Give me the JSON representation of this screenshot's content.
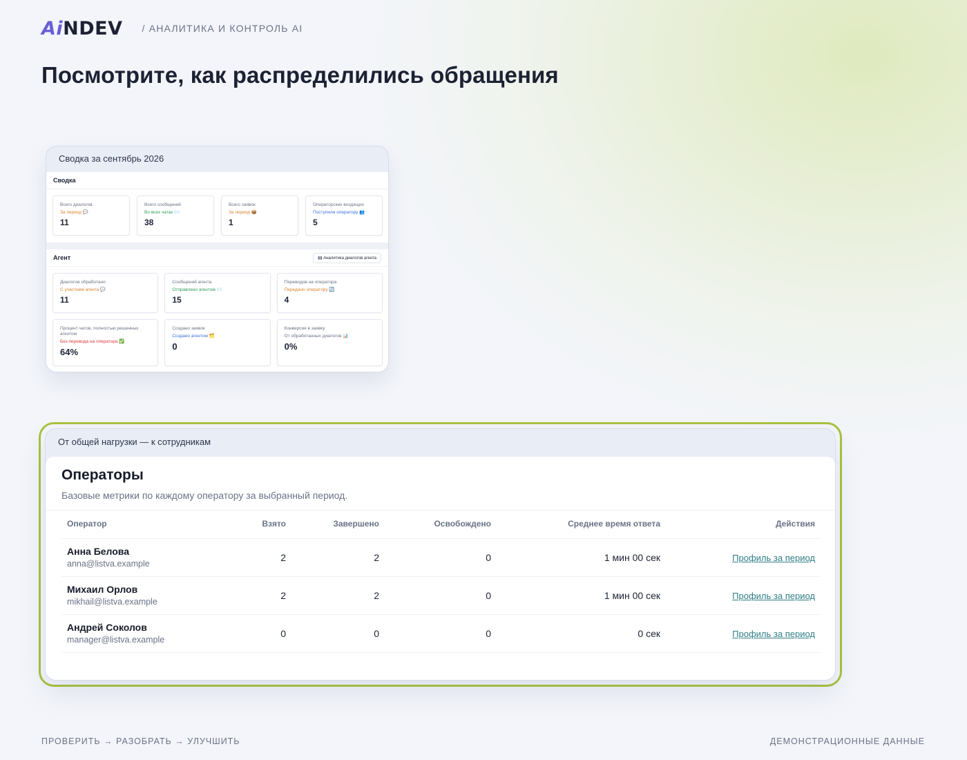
{
  "header": {
    "logo_ai": "Ai",
    "logo_rest": "NDEV",
    "tagline": "/ АНАЛИТИКА И КОНТРОЛЬ AI"
  },
  "page_title": "Посмотрите, как распределились обращения",
  "summary_card": {
    "caption": "Сводка за сентябрь 2026",
    "summary_section": "Сводка",
    "summary_metrics": [
      {
        "label": "Всего диалогов",
        "sub": "За период 💬",
        "value": "11"
      },
      {
        "label": "Всего сообщений",
        "sub": "Во всех чатах ✉️",
        "value": "38"
      },
      {
        "label": "Всего заявок",
        "sub": "За период 📦",
        "value": "1"
      },
      {
        "label": "Операторских входящих",
        "sub": "Поступили оператору 👥",
        "value": "5"
      }
    ],
    "agent_section": "Агент",
    "agent_button": "Аналитика диалогов агента",
    "agent_metrics": [
      {
        "label": "Диалогов обработано",
        "sub": "С участием агента 💬",
        "value": "11"
      },
      {
        "label": "Сообщений агента",
        "sub": "Отправлено агентом ✉️",
        "value": "15"
      },
      {
        "label": "Переводов на оператора",
        "sub": "Передано оператору 🔄",
        "value": "4"
      },
      {
        "label": "Процент чатов, полностью решенных агентом",
        "sub": "Без перевода на оператора ✅",
        "value": "64%"
      },
      {
        "label": "Создано заявок",
        "sub": "Создано агентом 🗂️",
        "value": "0"
      },
      {
        "label": "Конверсия в заявку",
        "sub": "От обработанных диалогов 📊",
        "value": "0%"
      }
    ]
  },
  "operators_card": {
    "caption": "От общей нагрузки — к сотрудникам",
    "title": "Операторы",
    "subtitle": "Базовые метрики по каждому оператору за выбранный период.",
    "columns": [
      "Оператор",
      "Взято",
      "Завершено",
      "Освобождено",
      "Среднее время ответа",
      "Действия"
    ],
    "rows": [
      {
        "name": "Анна Белова",
        "email": "anna@listva.example",
        "taken": "2",
        "completed": "2",
        "released": "0",
        "avg": "1 мин 00 сек",
        "action": "Профиль за период"
      },
      {
        "name": "Михаил Орлов",
        "email": "mikhail@listva.example",
        "taken": "2",
        "completed": "2",
        "released": "0",
        "avg": "1 мин 00 сек",
        "action": "Профиль за период"
      },
      {
        "name": "Андрей Соколов",
        "email": "manager@listva.example",
        "taken": "0",
        "completed": "0",
        "released": "0",
        "avg": "0 сек",
        "action": "Профиль за период"
      }
    ]
  },
  "footer": {
    "left": "ПРОВЕРИТЬ → РАЗОБРАТЬ → УЛУЧШИТЬ",
    "right": "ДЕМОНСТРАЦИОННЫЕ ДАННЫЕ"
  },
  "colors": {
    "accent_green_border": "#a9c23f",
    "logo_purple": "#6a5ed8",
    "link_teal": "#2f7e86"
  }
}
